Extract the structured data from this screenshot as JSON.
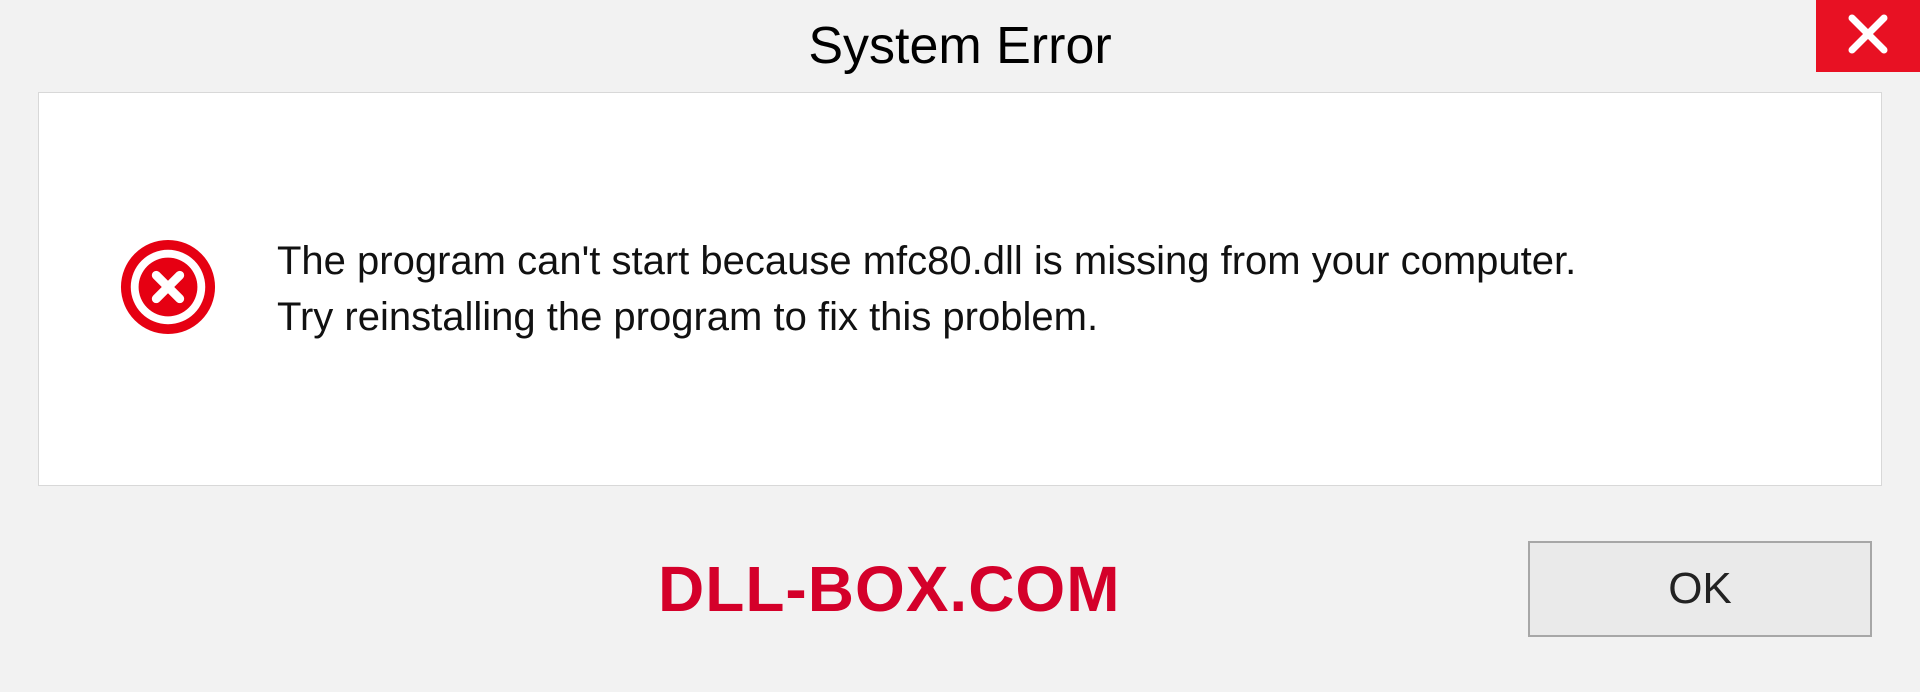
{
  "titlebar": {
    "title": "System Error"
  },
  "message": {
    "line1": "The program can't start because mfc80.dll is missing from your computer.",
    "line2": "Try reinstalling the program to fix this problem."
  },
  "footer": {
    "watermark": "DLL-BOX.COM",
    "ok_label": "OK"
  },
  "colors": {
    "close_bg": "#e81123",
    "error_icon": "#e60012",
    "watermark": "#d4002a"
  }
}
